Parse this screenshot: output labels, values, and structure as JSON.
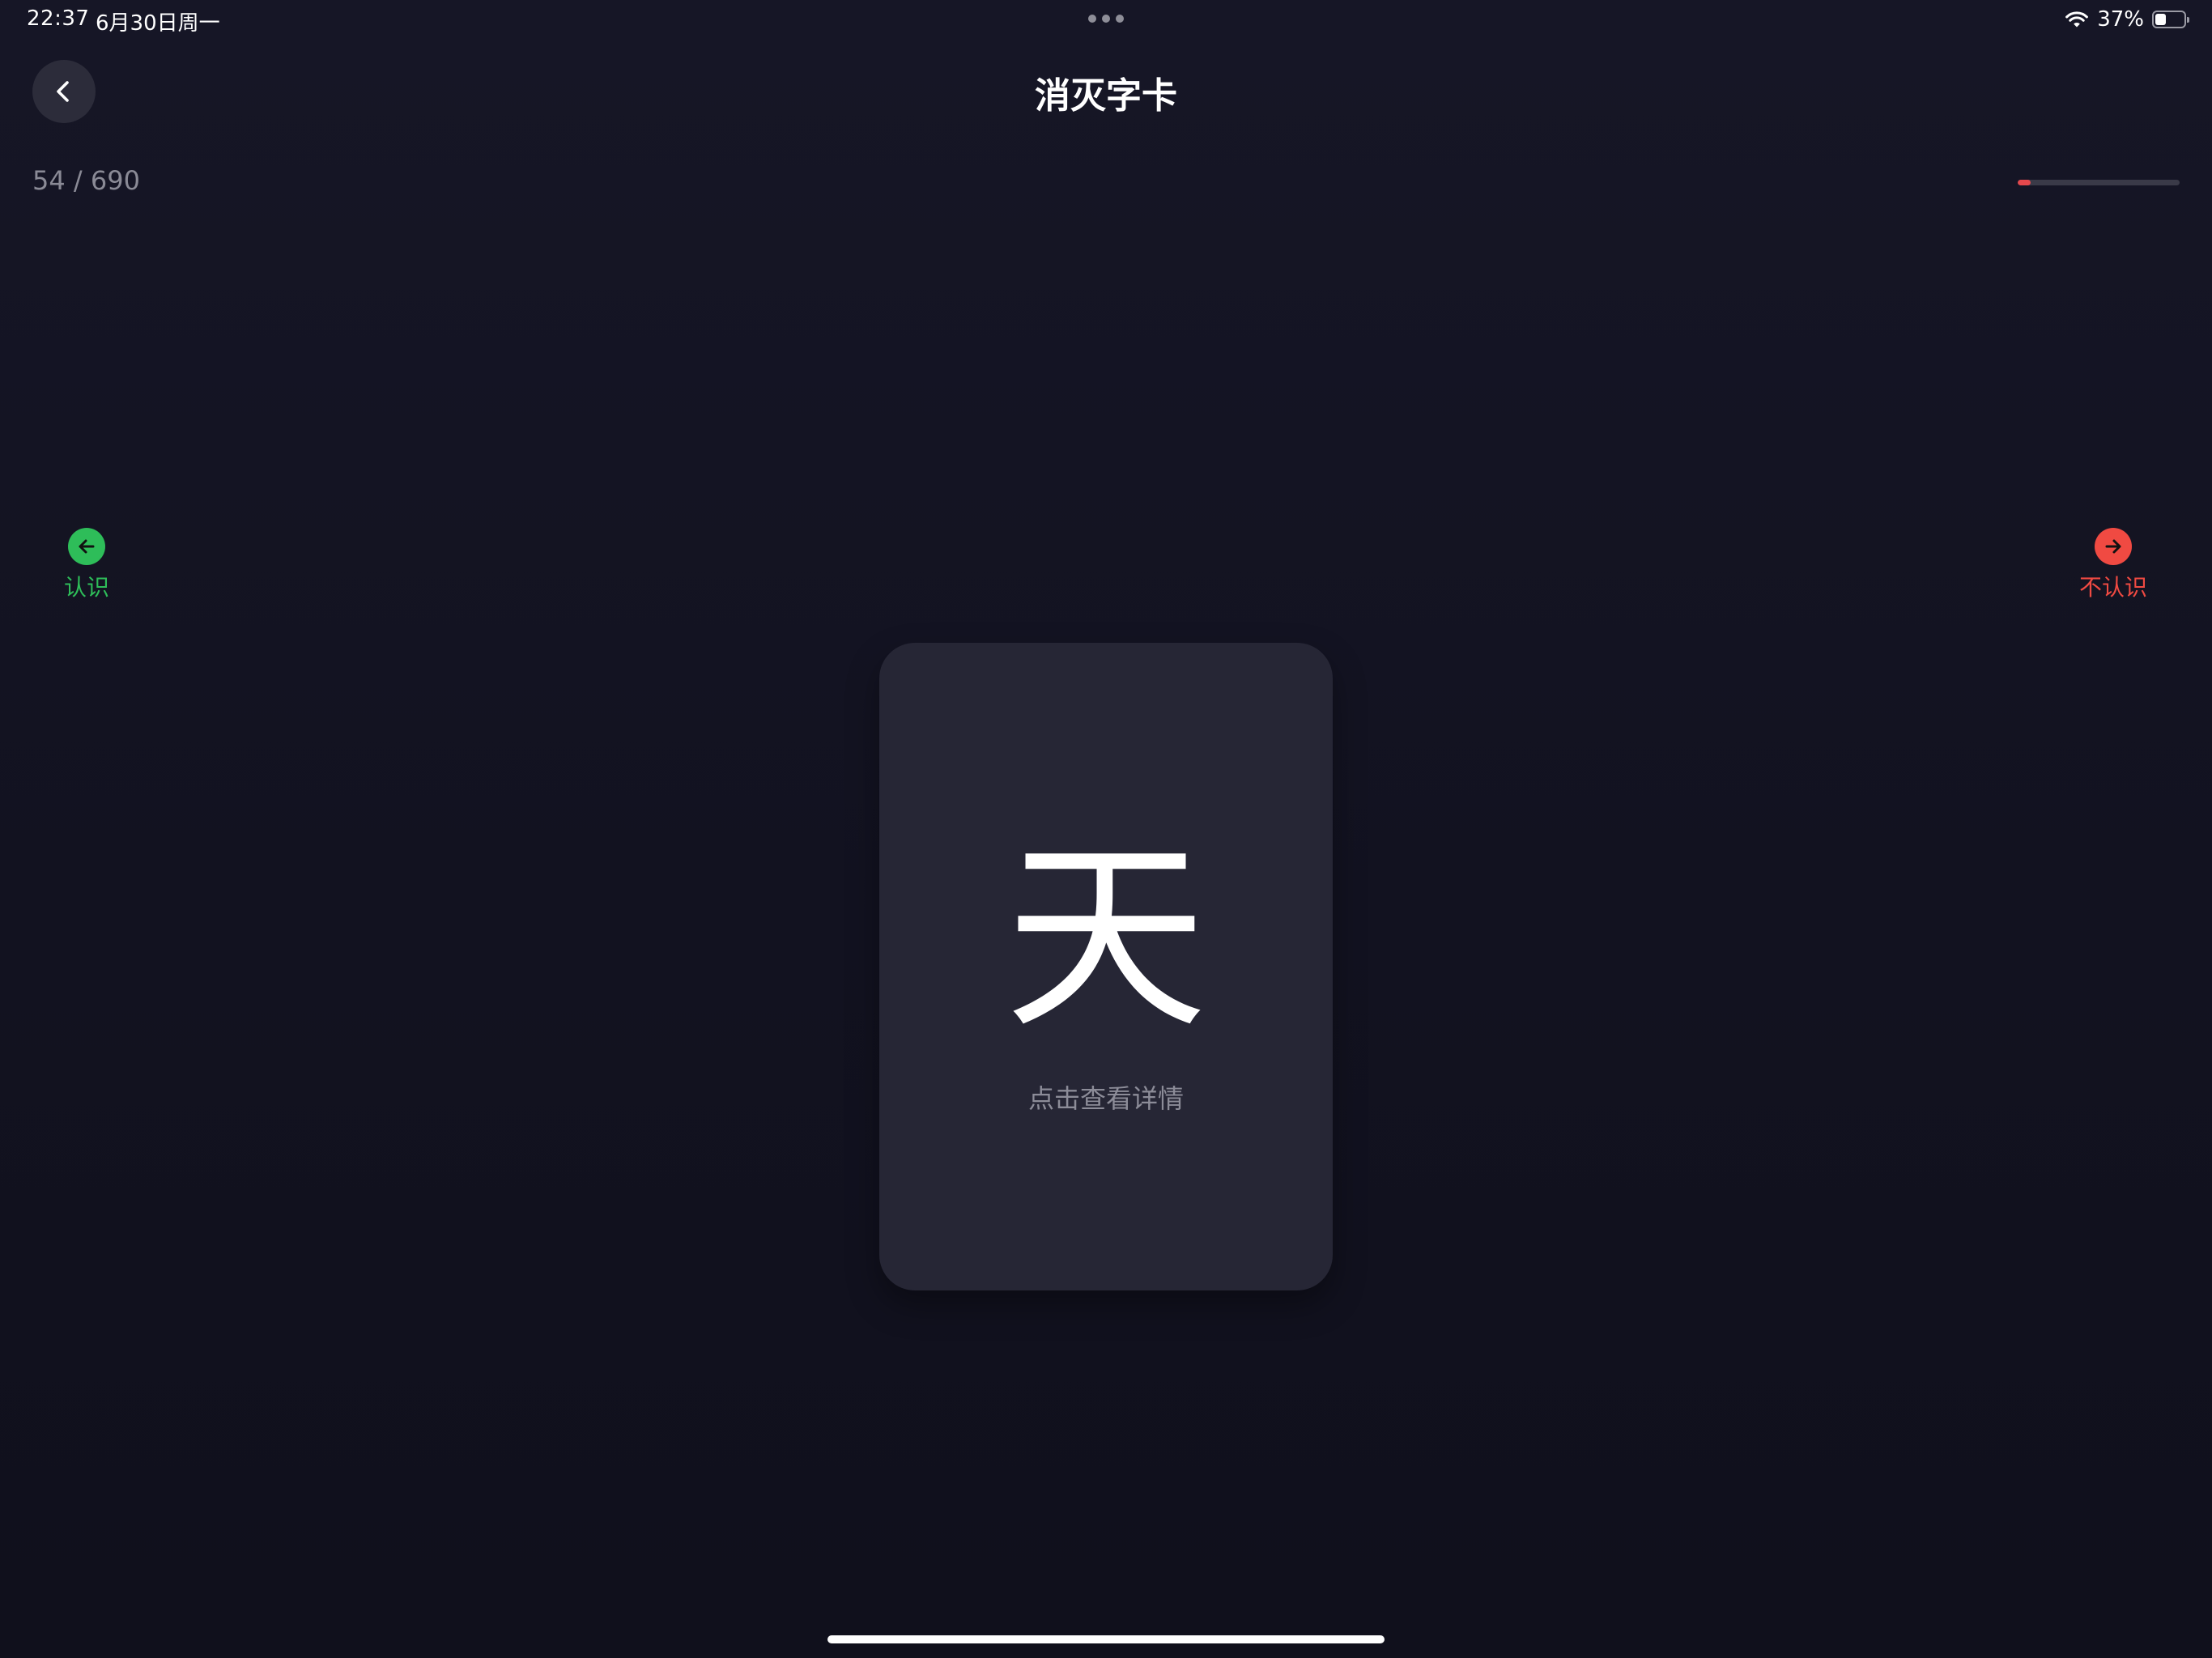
{
  "status_bar": {
    "time": "22:37",
    "date": "6月30日周一",
    "battery_percent": "37%",
    "battery_level": 0.37,
    "icons": [
      "wifi-icon",
      "battery-icon",
      "multitask-dots-icon"
    ]
  },
  "header": {
    "title": "消灭字卡",
    "back_icon": "chevron-left-icon"
  },
  "progress": {
    "counter_text": "54 / 690",
    "current": 54,
    "total": 690
  },
  "swipe_hints": {
    "left": {
      "label": "认识",
      "icon": "arrow-left-icon",
      "color": "#2ebd59"
    },
    "right": {
      "label": "不认识",
      "icon": "arrow-right-icon",
      "color": "#f04a42"
    }
  },
  "card": {
    "character": "天",
    "hint": "点击查看详情"
  },
  "colors": {
    "background": "#14141f",
    "card": "#262635",
    "progress_accent": "#e5484d"
  }
}
